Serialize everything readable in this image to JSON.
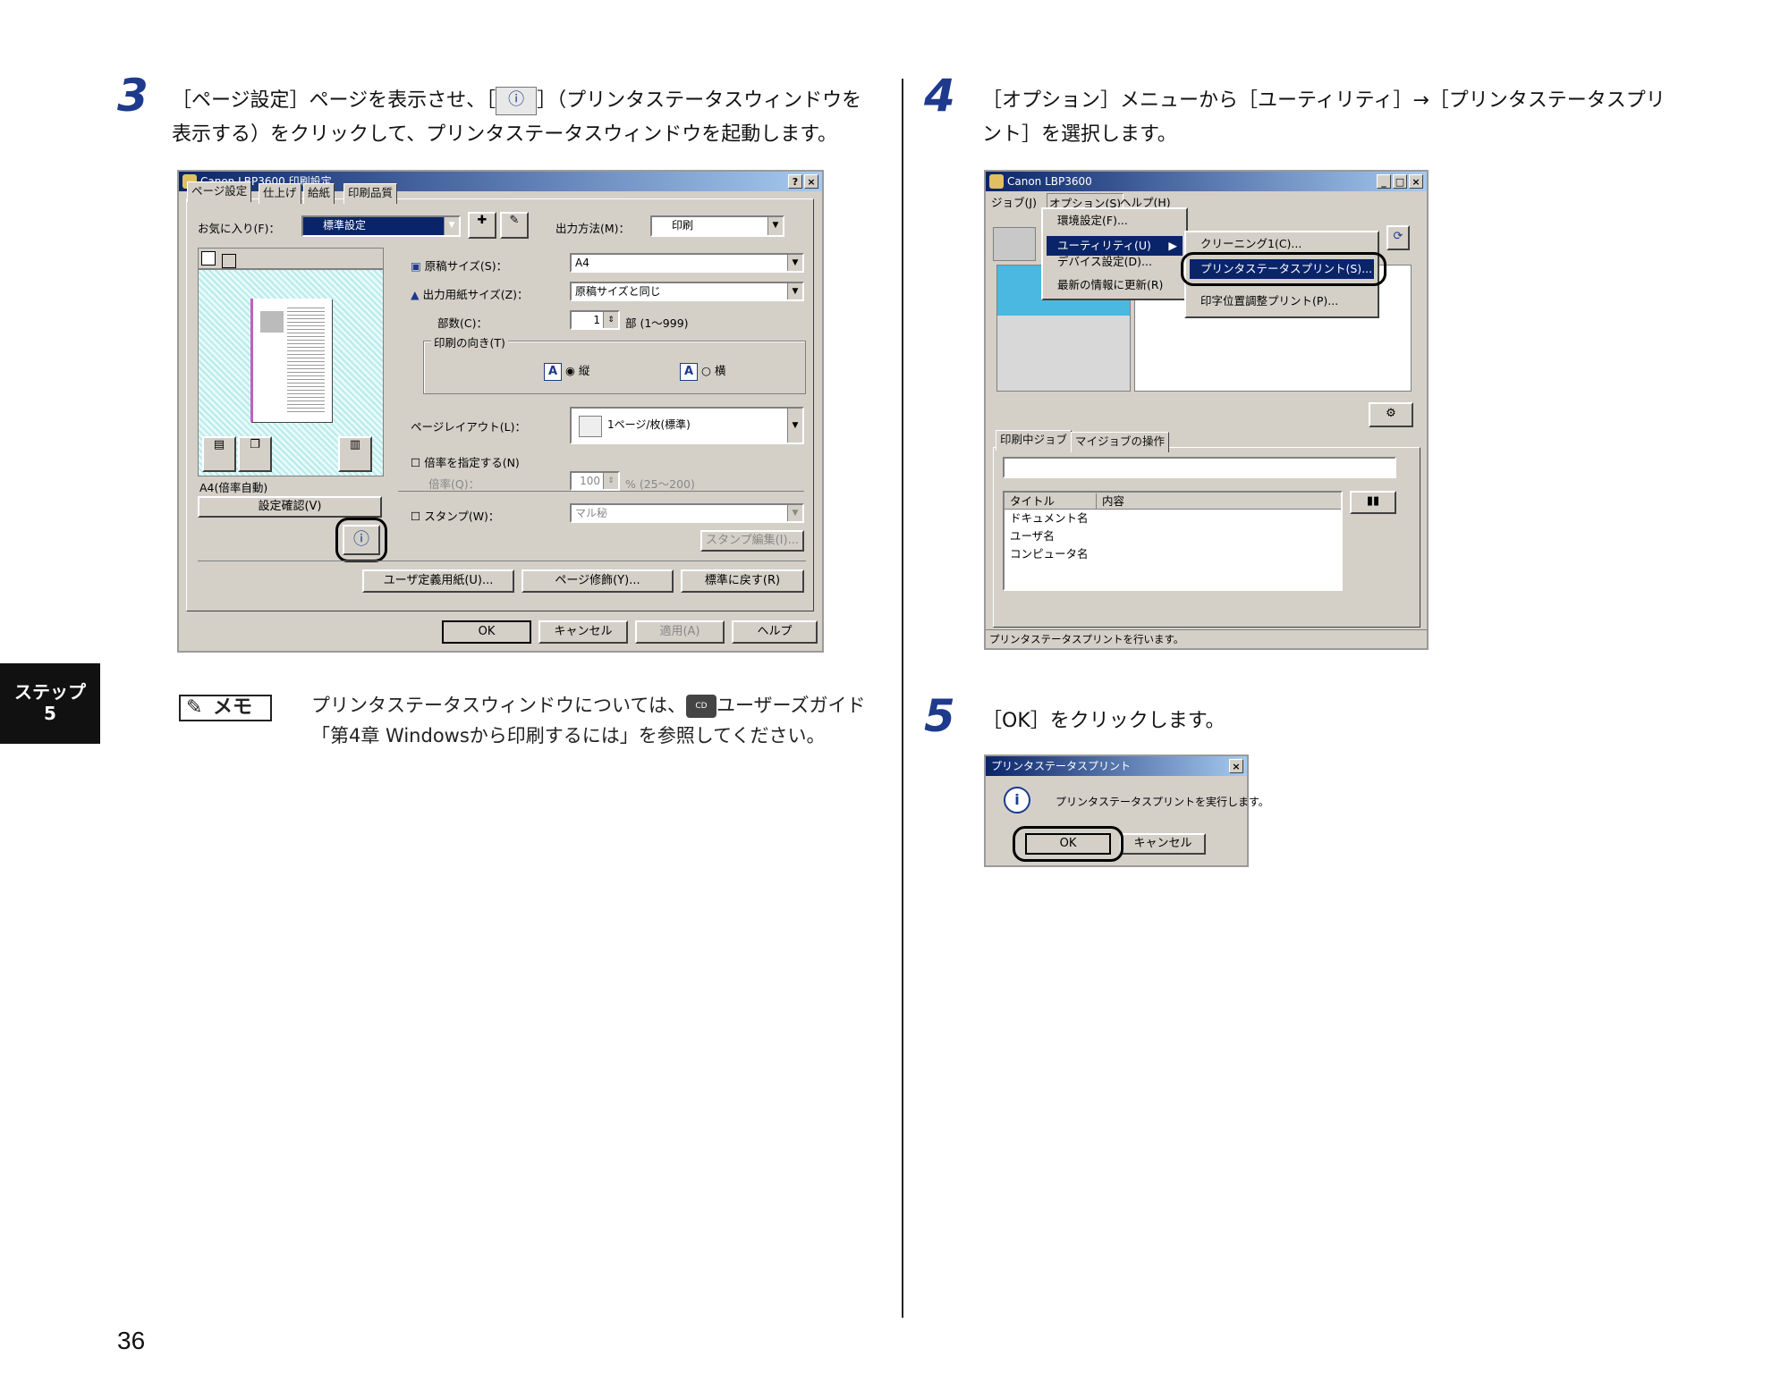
{
  "page_number": "36",
  "side_tab": {
    "line1": "ステップ",
    "line2": "5"
  },
  "step3": {
    "num": "3",
    "text_a": "［ページ設定］ページを表示させ、［",
    "text_b": "］（プリンタステータスウィンドウを",
    "text_c": "表示する）をクリックして、プリンタステータスウィンドウを起動します。"
  },
  "dialog3": {
    "title": "Canon LBP3600 印刷設定",
    "help_btn": "?",
    "close_btn": "×",
    "tabs": [
      "ページ設定",
      "仕上げ",
      "給紙",
      "印刷品質"
    ],
    "favorites_label": "お気に入り(F)：",
    "favorites_value": "標準設定",
    "output_method_label": "出力方法(M)：",
    "output_method_value": "印刷",
    "orig_size_label": "原稿サイズ(S)：",
    "orig_size_value": "A4",
    "paper_size_label": "出力用紙サイズ(Z)：",
    "paper_size_value": "原稿サイズと同じ",
    "copies_label": "部数(C)：",
    "copies_value": "1",
    "copies_unit": "部 (1～999)",
    "orientation_group": "印刷の向き(T)",
    "portrait": "縦",
    "landscape": "横",
    "layout_label": "ページレイアウト(L)：",
    "layout_value": "1ページ/枚(標準)",
    "scale_check": "倍率を指定する(N)",
    "scale_label": "倍率(Q)：",
    "scale_value": "100",
    "scale_range": "% (25～200)",
    "preview_caption": "A4(倍率自動)",
    "confirm_btn": "設定確認(V)",
    "stamp_check": "スタンプ(W)：",
    "stamp_value": "マル秘",
    "stamp_edit_btn": "スタンプ編集(I)...",
    "btn_custom_paper": "ユーザ定義用紙(U)...",
    "btn_page_decor": "ページ修飾(Y)...",
    "btn_restore": "標準に戻す(R)",
    "btn_ok": "OK",
    "btn_cancel": "キャンセル",
    "btn_apply": "適用(A)",
    "btn_help": "ヘルプ"
  },
  "memo": {
    "label": "メモ",
    "text_a": "プリンタステータスウィンドウについては、",
    "text_b": "ユーザーズガイド「第4章 Windowsから印刷するには」を参照してください。"
  },
  "step4": {
    "num": "4",
    "text_a": "［オプション］メニューから［ユーティリティ］→［プリンタステータスプリ",
    "text_b": "ント］を選択します。"
  },
  "dialog4": {
    "title": "Canon LBP3600",
    "menubar": [
      "ジョブ(J)",
      "オプション(S)",
      "ヘルプ(H)"
    ],
    "option_menu": [
      "環境設定(F)...",
      "ユーティリティ(U)",
      "デバイス設定(D)...",
      "最新の情報に更新(R)"
    ],
    "util_menu": [
      "クリーニング1(C)...",
      "プリンタステータスプリント(S)...",
      "印字位置調整プリント(P)..."
    ],
    "tabs": [
      "印刷中ジョブ",
      "マイジョブの操作"
    ],
    "list_headers": [
      "タイトル",
      "内容"
    ],
    "list_rows": [
      "ドキュメント名",
      "ユーザ名",
      "コンピュータ名"
    ],
    "status": "プリンタステータスプリントを行います。"
  },
  "step5": {
    "num": "5",
    "text": "［OK］をクリックします。"
  },
  "dialog5": {
    "title": "プリンタステータスプリント",
    "message": "プリンタステータスプリントを実行します。",
    "ok": "OK",
    "cancel": "キャンセル"
  }
}
